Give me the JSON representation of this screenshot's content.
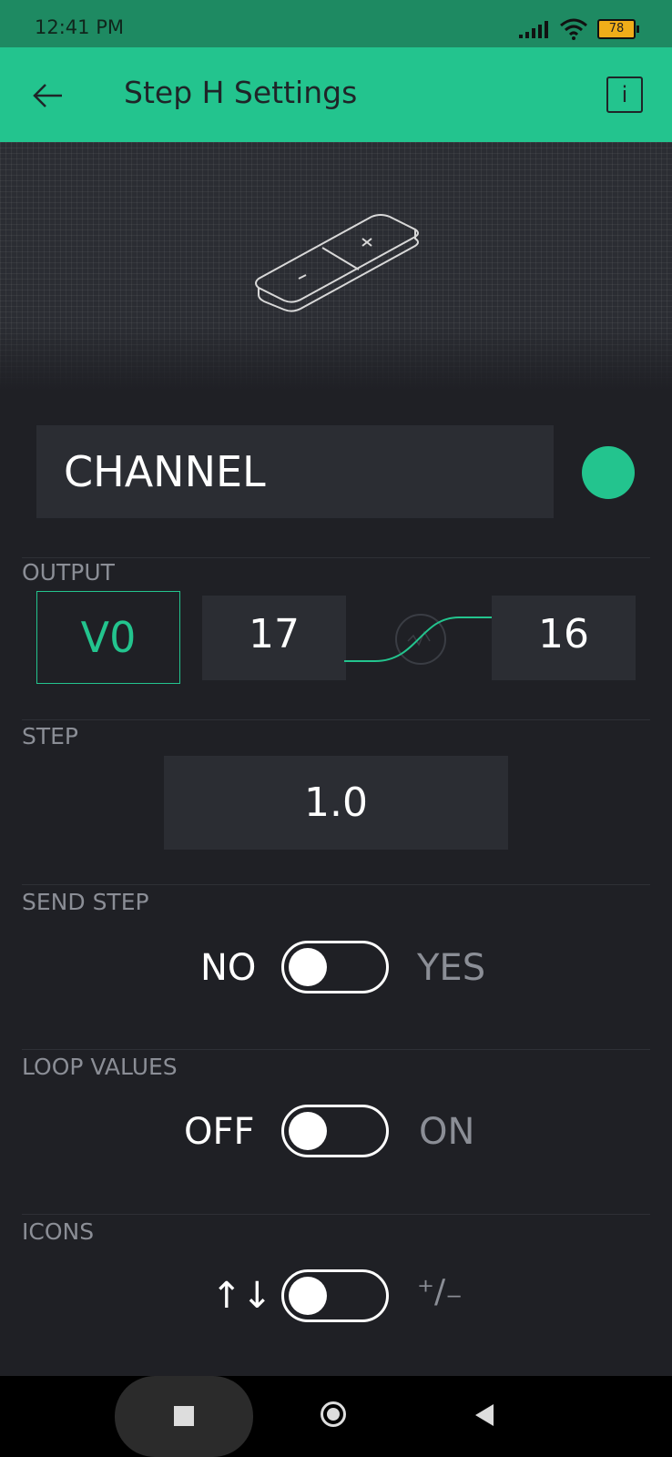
{
  "status_bar": {
    "time": "12:41 PM",
    "battery": "78",
    "icons": [
      "signal-icon",
      "wifi-icon",
      "battery-icon"
    ]
  },
  "app_bar": {
    "title": "Step H Settings",
    "back_icon": "arrow-left-icon",
    "info_label": "i"
  },
  "preview": {
    "widget_icon": "step-h-widget-icon"
  },
  "channel": {
    "label": "CHANNEL",
    "color": "#23c48e"
  },
  "output": {
    "label": "OUTPUT",
    "pin": "V0",
    "min": "17",
    "max": "16",
    "curve_icon": "mapping-curve-icon"
  },
  "step": {
    "label": "STEP",
    "value": "1.0"
  },
  "send_step": {
    "label": "SEND STEP",
    "off_label": "NO",
    "on_label": "YES",
    "enabled": false
  },
  "loop_values": {
    "label": "LOOP VALUES",
    "off_label": "OFF",
    "on_label": "ON",
    "enabled": false
  },
  "icons_setting": {
    "label": "ICONS",
    "off_label": "↑↓",
    "on_label": "⁺/₋",
    "enabled": false
  },
  "colors": {
    "accent": "#23c48e",
    "background": "#1f2025",
    "field": "#2b2d33"
  },
  "nav_bar": {
    "icons": [
      "recents-square-icon",
      "home-circle-icon",
      "back-triangle-icon"
    ]
  }
}
